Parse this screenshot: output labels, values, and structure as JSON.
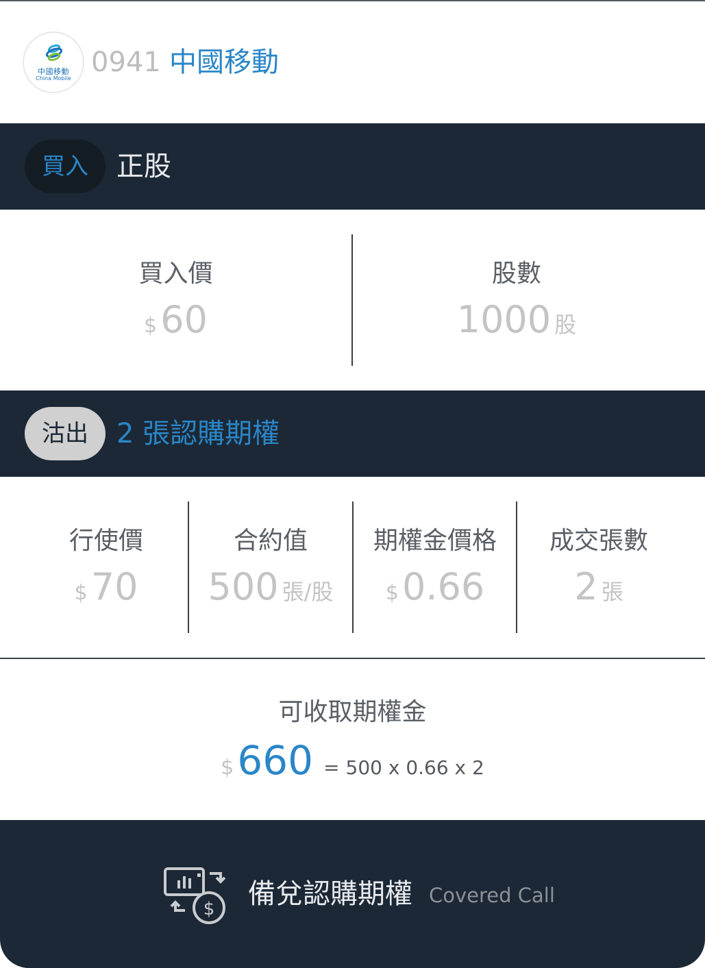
{
  "header": {
    "logo_cn": "中國移動",
    "logo_en": "China Mobile",
    "stock_code": "0941",
    "stock_name": "中國移動"
  },
  "stock_bar": {
    "action": "買入",
    "title": "正股"
  },
  "stock": {
    "price_label": "買入價",
    "price_currency": "$",
    "price_value": "60",
    "shares_label": "股數",
    "shares_value": "1000",
    "shares_unit": "股"
  },
  "option_bar": {
    "action": "沽出",
    "title": "2 張認購期權"
  },
  "option": {
    "strike_label": "行使價",
    "strike_currency": "$",
    "strike_value": "70",
    "contract_label": "合約值",
    "contract_value": "500",
    "contract_unit": "張/股",
    "premium_price_label": "期權金價格",
    "premium_price_currency": "$",
    "premium_price_value": "0.66",
    "lots_label": "成交張數",
    "lots_value": "2",
    "lots_unit": "張"
  },
  "premium": {
    "label": "可收取期權金",
    "currency": "$",
    "value": "660",
    "formula": "= 500 x 0.66 x 2"
  },
  "footer": {
    "icon": "cash-exchange-icon",
    "title": "備兌認購期權",
    "subtitle": "Covered Call"
  },
  "colors": {
    "accent": "#2a86c8",
    "dark_bar": "#1c2836",
    "muted_value": "#c4c4c4"
  }
}
